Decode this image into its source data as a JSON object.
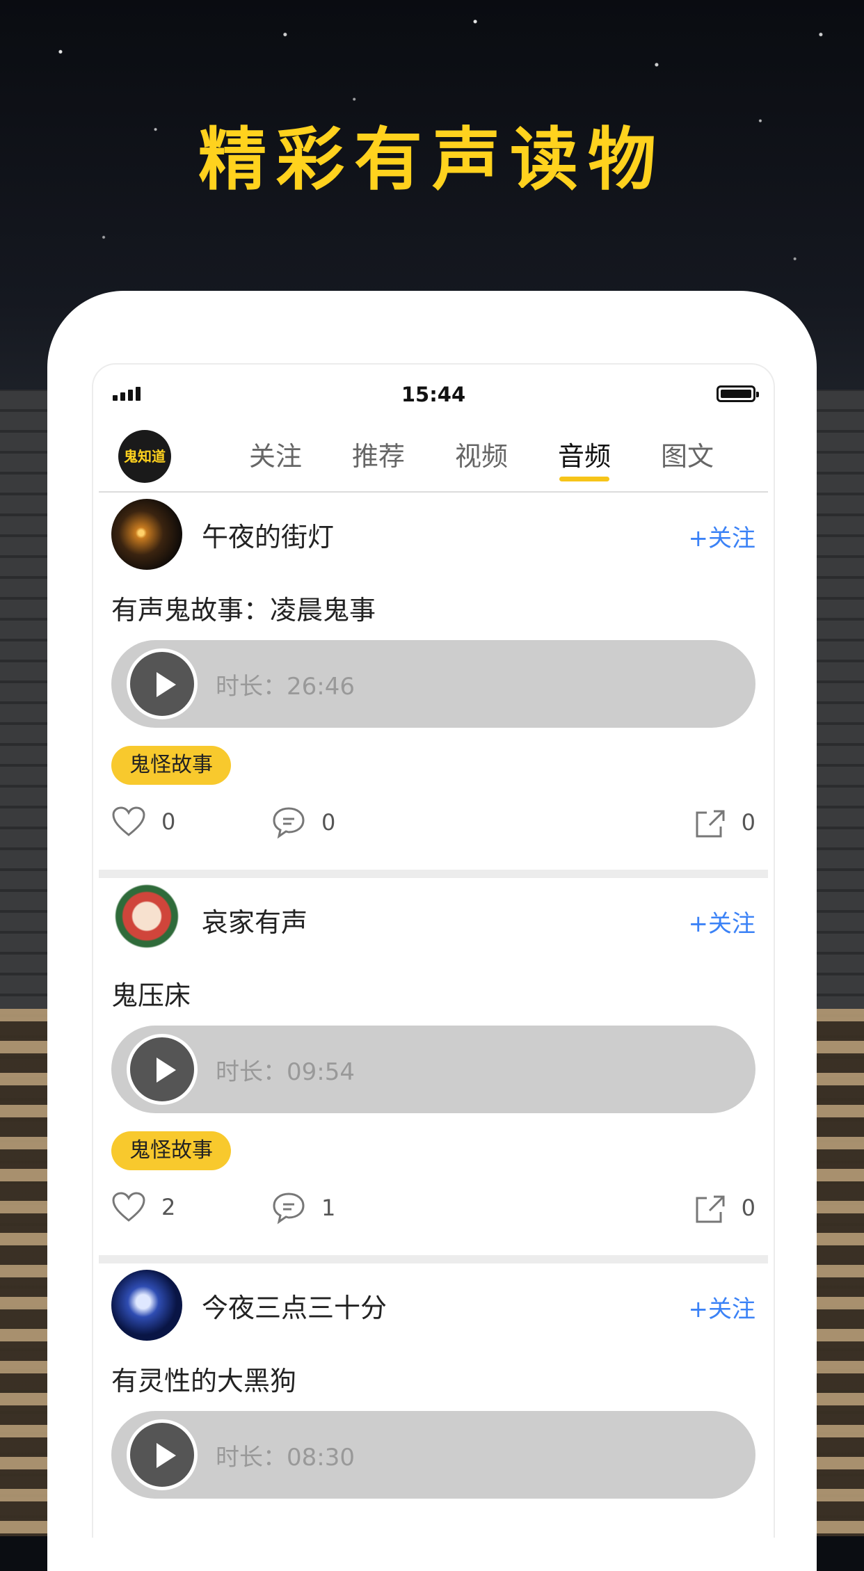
{
  "headline": "精彩有声读物",
  "status_bar": {
    "time": "15:44"
  },
  "nav": {
    "logo_text": "鬼知道",
    "tabs": [
      {
        "label": "关注",
        "active": false
      },
      {
        "label": "推荐",
        "active": false
      },
      {
        "label": "视频",
        "active": false
      },
      {
        "label": "音频",
        "active": true
      },
      {
        "label": "图文",
        "active": false
      }
    ]
  },
  "posts": [
    {
      "author": "午夜的街灯",
      "follow_label": "+关注",
      "title": "有声鬼故事：凌晨鬼事",
      "duration_label": "时长：26:46",
      "tag": "鬼怪故事",
      "likes": "0",
      "comments": "0",
      "shares": "0"
    },
    {
      "author": "哀家有声",
      "follow_label": "+关注",
      "title": "鬼压床",
      "duration_label": "时长：09:54",
      "tag": "鬼怪故事",
      "likes": "2",
      "comments": "1",
      "shares": "0"
    },
    {
      "author": "今夜三点三十分",
      "follow_label": "+关注",
      "title": "有灵性的大黑狗",
      "duration_label": "时长：08:30"
    }
  ],
  "colors": {
    "headline": "#ffd21e",
    "accent_yellow": "#f8c92d",
    "follow_blue": "#3b82f6",
    "audio_bar": "#cdcdcd"
  }
}
